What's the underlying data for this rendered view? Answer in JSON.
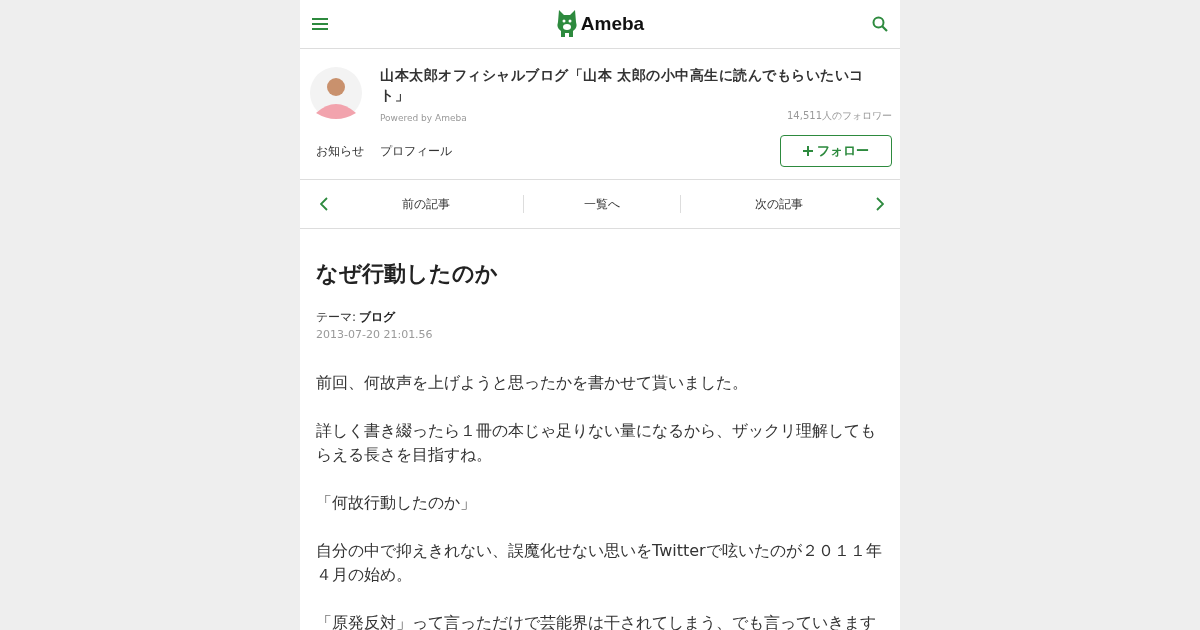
{
  "header": {
    "logo": "Ameba"
  },
  "blog": {
    "title": "山本太郎オフィシャルブログ「山本 太郎の小中高生に読んでもらいたいコト」",
    "powered_by": "Powered by Ameba",
    "followers": "14,511人のフォロワー",
    "links": [
      "お知らせ",
      "プロフィール"
    ],
    "follow_button": "フォロー"
  },
  "article_nav": {
    "prev": "前の記事",
    "list": "一覧へ",
    "next": "次の記事"
  },
  "article": {
    "title": "なぜ行動したのか",
    "theme_label": "テーマ:",
    "theme": "ブログ",
    "date": "2013-07-20 21:01.56",
    "paragraphs": [
      "前回、何故声を上げようと思ったかを書かせて貰いました。",
      "詳しく書き綴ったら１冊の本じゃ足りない量になるから、ザックリ理解してもらえる長さを目指すね。",
      "「何故行動したのか」",
      "自分の中で抑えきれない、誤魔化せない思いをTwitterで呟いたのが２０１１年４月の始め。",
      "「原発反対」って言っただけで芸能界は干されてしまう、でも言っていきます"
    ]
  }
}
